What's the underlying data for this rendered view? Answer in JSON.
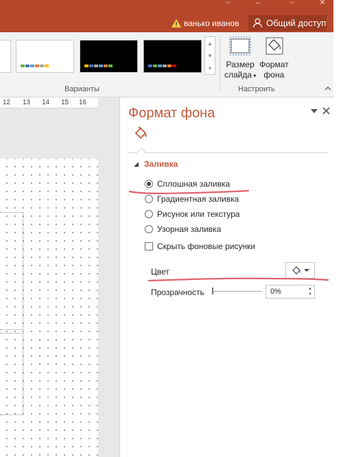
{
  "titlebar": {
    "user_name": "ванько иванов",
    "share_label": "Общий доступ"
  },
  "ribbon": {
    "variants_group_label": "Варианты",
    "customize_group_label": "Настроить",
    "slide_size": {
      "line1": "Размер",
      "line2": "слайда"
    },
    "format_background": {
      "line1": "Формат",
      "line2": "фона"
    },
    "variant_swatches": [
      [
        "#70ad47",
        "#4472c4",
        "#5b9bd5",
        "#ed7d31",
        "#a5a5a5",
        "#ffc000"
      ],
      [
        "#ffc000",
        "#4472c4",
        "#a5a5a5",
        "#5b9bd5",
        "#ed7d31",
        "#70ad47"
      ],
      [
        "#4472c4",
        "#70ad47",
        "#5b9bd5",
        "#a5a5a5",
        "#ed7d31",
        "#c00000"
      ]
    ]
  },
  "ruler": {
    "ticks": [
      "12",
      "13",
      "14",
      "15",
      "16"
    ]
  },
  "pane": {
    "title": "Формат фона",
    "section": "Заливка",
    "options": [
      {
        "label": "Сплошная заливка",
        "selected": true
      },
      {
        "label": "Градиентная заливка",
        "selected": false
      },
      {
        "label": "Рисунок или текстура",
        "selected": false
      },
      {
        "label": "Узорная заливка",
        "selected": false
      }
    ],
    "hide_background_graphics": "Скрыть фоновые рисунки",
    "color_label": "Цвет",
    "transparency_label": "Прозрачность",
    "transparency_value": "0%"
  },
  "colors": {
    "accent": "#b7472a",
    "pane_title": "#c55a3c",
    "annotation_red": "#e0636b"
  }
}
